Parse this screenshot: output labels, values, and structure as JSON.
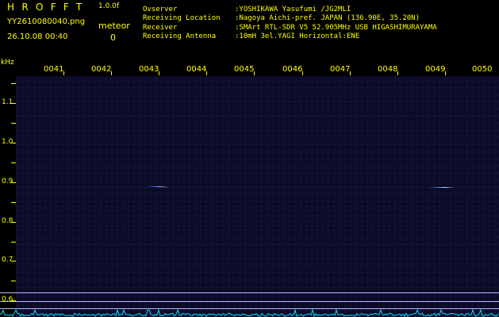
{
  "header": {
    "app_title": "HROFFT",
    "version": "1.0.0f",
    "file_name": "YY2610080040.png",
    "timestamp": "26.10.08 00:40",
    "counter_label": "meteor",
    "counter_value": "0"
  },
  "station": {
    "observer_key": "Ovserver",
    "observer_val": ":YOSHIKAWA Yasufumi /JG2MLI",
    "location_key": "Receiving Location",
    "location_val": ":Nagoya Aichi-pref. JAPAN (136.90E, 35.20N)",
    "receiver_key": "Receiver",
    "receiver_val": ":SMArt RTL-SDR V5 52.905MHz USB HIGASHIMURAYAMA",
    "antenna_key": "Receiving Antenna",
    "antenna_val": ":10mH 3el.YAGI Horizontal:ENE"
  },
  "plot": {
    "y_unit": "kHz",
    "time_labels": [
      "0041",
      "0042",
      "0043",
      "0044",
      "0045",
      "0046",
      "0047",
      "0048",
      "0049",
      "0050"
    ],
    "freq_labels": [
      "1.1",
      "1.0",
      "0.9",
      "0.8",
      "0.7",
      "0.6"
    ]
  },
  "colors": {
    "text": "#ffff00",
    "background": "#000000",
    "waterfall": "#0b0b28",
    "spectrum": "#00e5ff",
    "echo": "#4f7bff"
  }
}
